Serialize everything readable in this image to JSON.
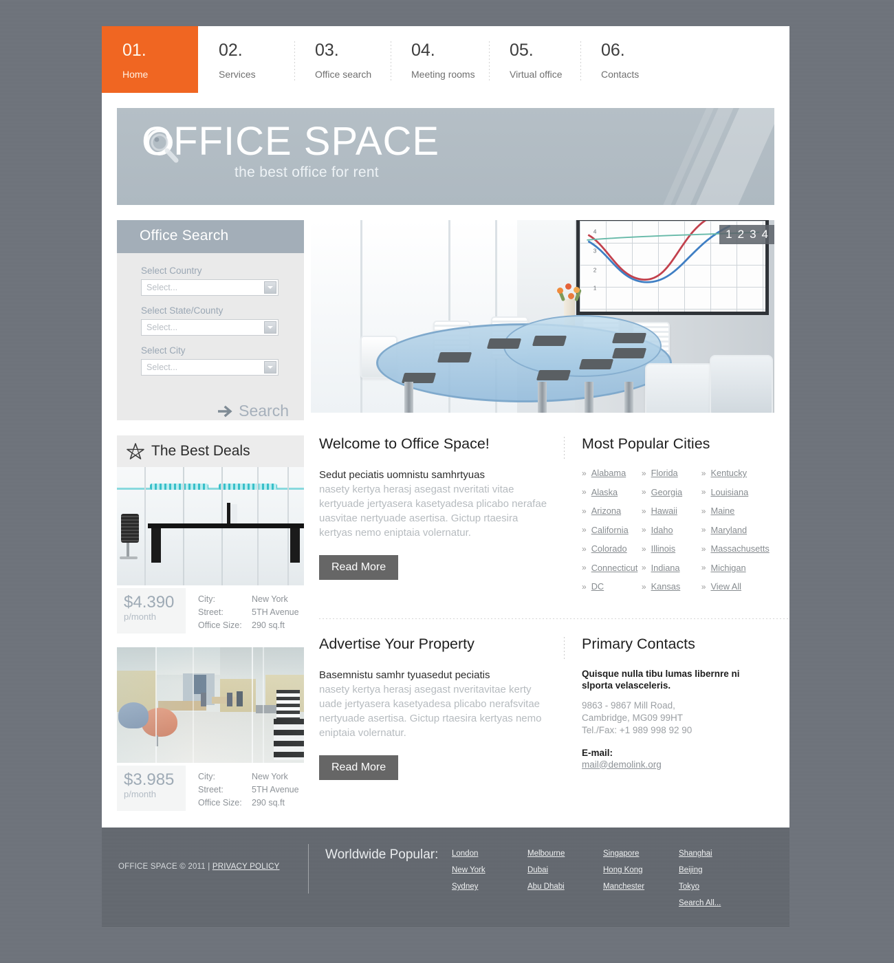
{
  "nav": {
    "items": [
      {
        "num": "01.",
        "label": "Home",
        "active": true
      },
      {
        "num": "02.",
        "label": "Services",
        "active": false
      },
      {
        "num": "03.",
        "label": "Office search",
        "active": false
      },
      {
        "num": "04.",
        "label": "Meeting rooms",
        "active": false
      },
      {
        "num": "05.",
        "label": "Virtual office",
        "active": false
      },
      {
        "num": "06.",
        "label": "Contacts",
        "active": false
      }
    ]
  },
  "banner": {
    "title": "OFFICE SPACE",
    "subtitle": "the best office for rent",
    "logo_icon": "magnifier-icon"
  },
  "search_panel": {
    "heading": "Office Search",
    "fields": [
      {
        "label": "Select Country",
        "placeholder": "Select...",
        "value": ""
      },
      {
        "label": "Select State/County",
        "placeholder": "Select...",
        "value": ""
      },
      {
        "label": "Select City",
        "placeholder": "Select...",
        "value": ""
      }
    ],
    "submit_label": "Search",
    "submit_icon": "arrow-right-icon"
  },
  "slider": {
    "pages": [
      "1",
      "2",
      "3",
      "4"
    ],
    "active_page": "1",
    "image_alt": "modern conference room with blue glass oval table and white chairs"
  },
  "deals": {
    "heading": "The Best Deals",
    "heading_icon": "star-icon",
    "items": [
      {
        "price": "$4.390",
        "period": "p/month",
        "rows": [
          {
            "key": "City:",
            "value": "New York"
          },
          {
            "key": "Street:",
            "value": "5TH Avenue"
          },
          {
            "key": "Office Size:",
            "value": "290 sq.ft"
          }
        ]
      },
      {
        "price": "$3.985",
        "period": "p/month",
        "rows": [
          {
            "key": "City:",
            "value": "New York"
          },
          {
            "key": "Street:",
            "value": "5TH Avenue"
          },
          {
            "key": "Office Size:",
            "value": "290 sq.ft"
          }
        ]
      }
    ]
  },
  "welcome": {
    "heading": "Welcome to Office Space!",
    "lead": "Sedut peciatis uomnistu samhrtyuas",
    "body": "nasety kertya herasj asegast nveritati vitae kertyuade jertyasera kasetyadesa plicabo nerafae uasvitae nertyuade asertisa. Gictup rtaesira kertyas nemo eniptaia volernatur.",
    "button": "Read More"
  },
  "cities": {
    "heading": "Most Popular Cities",
    "bullet": "»",
    "columns": [
      [
        "Alabama",
        "Alaska",
        "Arizona",
        "California",
        "Colorado",
        "Connecticut",
        "DC"
      ],
      [
        "Florida",
        "Georgia",
        "Hawaii",
        "Idaho",
        "Illinois",
        "Indiana",
        "Kansas"
      ],
      [
        "Kentucky",
        "Louisiana",
        "Maine",
        "Maryland",
        "Massachusetts",
        "Michigan",
        "View All"
      ]
    ]
  },
  "advertise": {
    "heading": "Advertise Your Property",
    "lead": "Basemnistu samhr tyuasedut peciatis",
    "body": "nasety kertya herasj asegast nveritavitae kerty uade jertyasera kasetyadesa plicabo nerafsvitae nertyuade asertisa. Gictup rtaesira kertyas nemo eniptaia volernatur.",
    "button": "Read More"
  },
  "contacts": {
    "heading": "Primary Contacts",
    "company": "Quisque nulla tibu lumas libernre ni slporta velasceleris.",
    "address1": "9863 - 9867 Mill Road,",
    "address2": "Cambridge, MG09 99HT",
    "phone": "Tel./Fax:  +1 989 998 92 90",
    "email_label": "E-mail:",
    "email": "mail@demolink.org"
  },
  "footer": {
    "copyright": "OFFICE SPACE © 2011 | ",
    "privacy": "PRIVACY POLICY",
    "worldwide_label": "Worldwide Popular:",
    "columns": [
      [
        "London",
        "New York",
        "Sydney"
      ],
      [
        "Melbourne",
        "Dubai",
        "Abu Dhabi"
      ],
      [
        "Singapore",
        "Hong Kong",
        "Manchester"
      ],
      [
        "Shanghai",
        "Beijing",
        "Tokyo",
        "Search All..."
      ]
    ]
  },
  "colors": {
    "accent_orange": "#f06622",
    "banner_gray": "#b0bac2",
    "panel_head": "#a3aeb8",
    "page_bg": "#6e737b",
    "footer_bg": "#63686f",
    "button_gray": "#666666",
    "price_blue": "#9eaab5"
  }
}
